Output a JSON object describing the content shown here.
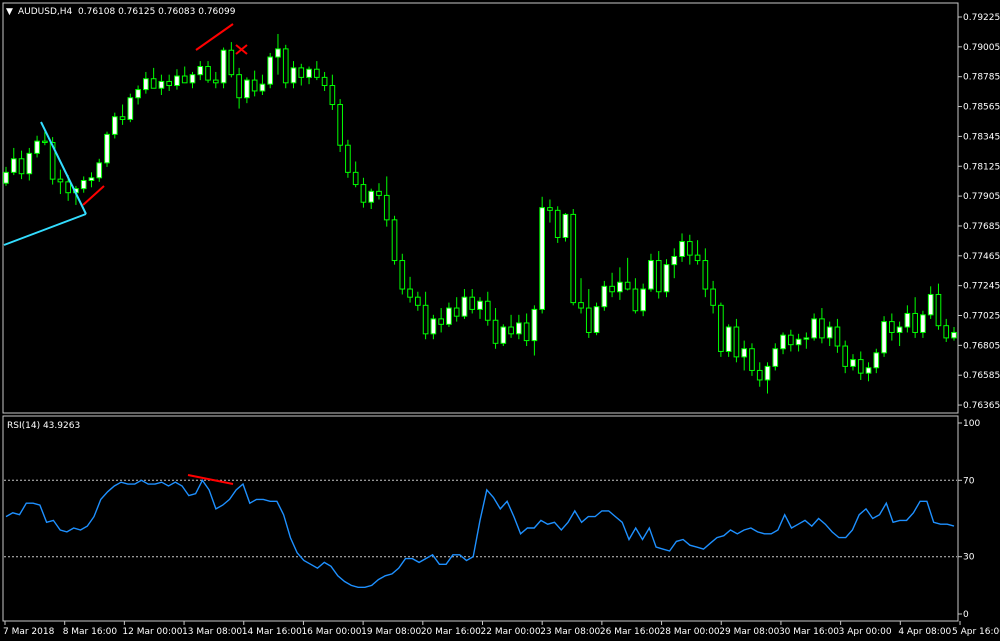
{
  "chart_data": [
    {
      "type": "candlestick",
      "symbol_label": "AUDUSD,H4",
      "ohlc_label": "0.76108 0.76125 0.76083 0.76099",
      "y_ticks": [
        "0.79225",
        "0.79005",
        "0.78785",
        "0.78565",
        "0.78345",
        "0.78125",
        "0.77905",
        "0.77685",
        "0.77465",
        "0.77245",
        "0.77025",
        "0.76805",
        "0.76585",
        "0.76365"
      ],
      "ylim": [
        0.7632,
        0.793
      ],
      "colors": {
        "candle": "#00ff00",
        "bull_body": "#ffffff",
        "bear_body": "#000000",
        "trendline": "#33ddff",
        "divergence": "#ff0000",
        "axis": "#ffffff"
      },
      "candles": [
        [
          0.78,
          0.7812,
          0.7798,
          0.7808
        ],
        [
          0.7808,
          0.7826,
          0.7806,
          0.7818
        ],
        [
          0.7818,
          0.7824,
          0.7803,
          0.7807
        ],
        [
          0.7807,
          0.7826,
          0.7802,
          0.7822
        ],
        [
          0.7822,
          0.7835,
          0.7819,
          0.7831
        ],
        [
          0.7831,
          0.7838,
          0.7828,
          0.783
        ],
        [
          0.783,
          0.7834,
          0.7799,
          0.7803
        ],
        [
          0.7803,
          0.781,
          0.7792,
          0.7801
        ],
        [
          0.7801,
          0.7806,
          0.7787,
          0.7793
        ],
        [
          0.7793,
          0.7798,
          0.7784,
          0.7796
        ],
        [
          0.7796,
          0.7805,
          0.7793,
          0.7802
        ],
        [
          0.7802,
          0.7808,
          0.7797,
          0.7804
        ],
        [
          0.7804,
          0.7818,
          0.7801,
          0.7815
        ],
        [
          0.7815,
          0.7838,
          0.7812,
          0.7836
        ],
        [
          0.7836,
          0.7852,
          0.7833,
          0.7849
        ],
        [
          0.7849,
          0.7858,
          0.7843,
          0.7847
        ],
        [
          0.7847,
          0.7866,
          0.7845,
          0.7863
        ],
        [
          0.7863,
          0.7872,
          0.7858,
          0.7869
        ],
        [
          0.7869,
          0.7882,
          0.7866,
          0.7877
        ],
        [
          0.7877,
          0.7885,
          0.787,
          0.787
        ],
        [
          0.787,
          0.788,
          0.7865,
          0.7875
        ],
        [
          0.7875,
          0.788,
          0.7868,
          0.7872
        ],
        [
          0.7872,
          0.7884,
          0.7869,
          0.7879
        ],
        [
          0.7879,
          0.7886,
          0.7874,
          0.7874
        ],
        [
          0.7874,
          0.7882,
          0.787,
          0.788
        ],
        [
          0.788,
          0.789,
          0.7876,
          0.7886
        ],
        [
          0.7886,
          0.789,
          0.7874,
          0.7876
        ],
        [
          0.7876,
          0.7882,
          0.787,
          0.7874
        ],
        [
          0.7874,
          0.79,
          0.787,
          0.7898
        ],
        [
          0.7898,
          0.7904,
          0.7878,
          0.788
        ],
        [
          0.788,
          0.7885,
          0.7855,
          0.7863
        ],
        [
          0.7863,
          0.7878,
          0.7859,
          0.7876
        ],
        [
          0.7876,
          0.7883,
          0.7864,
          0.7868
        ],
        [
          0.7868,
          0.788,
          0.7865,
          0.7873
        ],
        [
          0.7873,
          0.7896,
          0.787,
          0.7893
        ],
        [
          0.7893,
          0.791,
          0.788,
          0.7899
        ],
        [
          0.7899,
          0.7902,
          0.787,
          0.7874
        ],
        [
          0.7874,
          0.789,
          0.787,
          0.7885
        ],
        [
          0.7885,
          0.7888,
          0.7872,
          0.7878
        ],
        [
          0.7878,
          0.7886,
          0.7873,
          0.7884
        ],
        [
          0.7884,
          0.789,
          0.7876,
          0.7878
        ],
        [
          0.7878,
          0.7882,
          0.7868,
          0.7872
        ],
        [
          0.7872,
          0.788,
          0.7854,
          0.7858
        ],
        [
          0.7858,
          0.7862,
          0.7823,
          0.7828
        ],
        [
          0.7828,
          0.7832,
          0.7804,
          0.7808
        ],
        [
          0.7808,
          0.7816,
          0.7797,
          0.7799
        ],
        [
          0.7799,
          0.7804,
          0.7782,
          0.7786
        ],
        [
          0.7786,
          0.7796,
          0.7781,
          0.7794
        ],
        [
          0.7794,
          0.78,
          0.7788,
          0.7791
        ],
        [
          0.7791,
          0.7805,
          0.7768,
          0.7773
        ],
        [
          0.7773,
          0.7776,
          0.774,
          0.7743
        ],
        [
          0.7743,
          0.7748,
          0.7718,
          0.7722
        ],
        [
          0.7722,
          0.7731,
          0.7712,
          0.7716
        ],
        [
          0.7716,
          0.772,
          0.7706,
          0.771
        ],
        [
          0.771,
          0.772,
          0.7685,
          0.7689
        ],
        [
          0.7689,
          0.7703,
          0.7685,
          0.77
        ],
        [
          0.77,
          0.7708,
          0.769,
          0.7696
        ],
        [
          0.7696,
          0.7712,
          0.7694,
          0.7708
        ],
        [
          0.7708,
          0.7716,
          0.7698,
          0.7702
        ],
        [
          0.7702,
          0.7722,
          0.77,
          0.7716
        ],
        [
          0.7716,
          0.7722,
          0.7704,
          0.7707
        ],
        [
          0.7707,
          0.7716,
          0.77,
          0.7713
        ],
        [
          0.7713,
          0.772,
          0.7695,
          0.7699
        ],
        [
          0.7699,
          0.7708,
          0.7678,
          0.7682
        ],
        [
          0.7682,
          0.7696,
          0.768,
          0.7694
        ],
        [
          0.7694,
          0.7703,
          0.7686,
          0.7689
        ],
        [
          0.7689,
          0.7703,
          0.7685,
          0.7697
        ],
        [
          0.7697,
          0.7704,
          0.768,
          0.7684
        ],
        [
          0.7684,
          0.771,
          0.7673,
          0.7707
        ],
        [
          0.7707,
          0.779,
          0.7704,
          0.7782
        ],
        [
          0.7782,
          0.7788,
          0.7771,
          0.778
        ],
        [
          0.778,
          0.7783,
          0.7756,
          0.776
        ],
        [
          0.776,
          0.7778,
          0.7757,
          0.7777
        ],
        [
          0.7777,
          0.7781,
          0.771,
          0.7712
        ],
        [
          0.7712,
          0.773,
          0.7704,
          0.7708
        ],
        [
          0.7708,
          0.7722,
          0.7686,
          0.769
        ],
        [
          0.769,
          0.7712,
          0.7688,
          0.7709
        ],
        [
          0.7709,
          0.7728,
          0.7706,
          0.7724
        ],
        [
          0.7724,
          0.7734,
          0.7716,
          0.772
        ],
        [
          0.772,
          0.7738,
          0.7714,
          0.7727
        ],
        [
          0.7727,
          0.7745,
          0.7721,
          0.7722
        ],
        [
          0.7722,
          0.773,
          0.7704,
          0.7706
        ],
        [
          0.7706,
          0.7726,
          0.7702,
          0.7722
        ],
        [
          0.7722,
          0.7748,
          0.772,
          0.7743
        ],
        [
          0.7743,
          0.775,
          0.7715,
          0.772
        ],
        [
          0.772,
          0.7744,
          0.7716,
          0.774
        ],
        [
          0.774,
          0.7752,
          0.773,
          0.7746
        ],
        [
          0.7746,
          0.7763,
          0.7742,
          0.7757
        ],
        [
          0.7757,
          0.7762,
          0.774,
          0.7747
        ],
        [
          0.7747,
          0.7758,
          0.774,
          0.7743
        ],
        [
          0.7743,
          0.7752,
          0.7716,
          0.7722
        ],
        [
          0.7722,
          0.7728,
          0.7704,
          0.771
        ],
        [
          0.771,
          0.7712,
          0.7672,
          0.7676
        ],
        [
          0.7676,
          0.7696,
          0.7672,
          0.7694
        ],
        [
          0.7694,
          0.77,
          0.7668,
          0.7672
        ],
        [
          0.7672,
          0.7684,
          0.7662,
          0.7678
        ],
        [
          0.7678,
          0.7682,
          0.7658,
          0.7662
        ],
        [
          0.7662,
          0.7668,
          0.765,
          0.7655
        ],
        [
          0.7655,
          0.7668,
          0.7645,
          0.7665
        ],
        [
          0.7665,
          0.7682,
          0.7662,
          0.7678
        ],
        [
          0.7678,
          0.769,
          0.7674,
          0.7688
        ],
        [
          0.7688,
          0.7692,
          0.7676,
          0.7681
        ],
        [
          0.7681,
          0.7689,
          0.7676,
          0.7685
        ],
        [
          0.7685,
          0.769,
          0.7678,
          0.7686
        ],
        [
          0.7686,
          0.7704,
          0.7684,
          0.77
        ],
        [
          0.77,
          0.7708,
          0.7682,
          0.7686
        ],
        [
          0.7686,
          0.7698,
          0.768,
          0.7694
        ],
        [
          0.7694,
          0.77,
          0.7675,
          0.768
        ],
        [
          0.768,
          0.7684,
          0.766,
          0.7665
        ],
        [
          0.7665,
          0.7674,
          0.7662,
          0.767
        ],
        [
          0.767,
          0.7676,
          0.7655,
          0.766
        ],
        [
          0.766,
          0.7668,
          0.7654,
          0.7664
        ],
        [
          0.7664,
          0.7678,
          0.766,
          0.7675
        ],
        [
          0.7675,
          0.7702,
          0.7672,
          0.7698
        ],
        [
          0.7698,
          0.7704,
          0.7684,
          0.769
        ],
        [
          0.769,
          0.7698,
          0.768,
          0.7694
        ],
        [
          0.7694,
          0.771,
          0.769,
          0.7704
        ],
        [
          0.7704,
          0.7716,
          0.7686,
          0.769
        ],
        [
          0.769,
          0.7706,
          0.7686,
          0.7703
        ],
        [
          0.7703,
          0.7724,
          0.77,
          0.7718
        ],
        [
          0.7718,
          0.7726,
          0.7692,
          0.7695
        ],
        [
          0.7695,
          0.77,
          0.7683,
          0.7686
        ],
        [
          0.7686,
          0.7694,
          0.7684,
          0.769
        ]
      ],
      "x_labels": [
        "7 Mar 2018",
        "8 Mar 16:00",
        "12 Mar 00:00",
        "13 Mar 08:00",
        "14 Mar 16:00",
        "16 Mar 00:00",
        "19 Mar 08:00",
        "20 Mar 16:00",
        "22 Mar 00:00",
        "23 Mar 08:00",
        "26 Mar 16:00",
        "28 Mar 00:00",
        "29 Mar 08:00",
        "30 Mar 16:00",
        "3 Apr 00:00",
        "4 Apr 08:00",
        "5 Apr 16:00"
      ]
    },
    {
      "type": "line",
      "indicator_label": "RSI(14) 43.9263",
      "y_ticks": [
        "100",
        "70",
        "30",
        "0"
      ],
      "ylim": [
        0,
        100
      ],
      "levels": [
        70,
        30
      ],
      "series": [
        {
          "color": "#1e90ff",
          "values": [
            51,
            53,
            52,
            58,
            58,
            57,
            48,
            49,
            44,
            43,
            45,
            44,
            46,
            51,
            60,
            64,
            67,
            69,
            68,
            68,
            70,
            68,
            68,
            69,
            67,
            69,
            67,
            62,
            63,
            70,
            65,
            55,
            57,
            60,
            65,
            68,
            58,
            60,
            60,
            59,
            59,
            52,
            40,
            32,
            28,
            26,
            24,
            27,
            25,
            20,
            17,
            15,
            14,
            14,
            15,
            18,
            20,
            21,
            24,
            29,
            29,
            27,
            29,
            31,
            26,
            26,
            31,
            31,
            28,
            30,
            49,
            65,
            61,
            55,
            59,
            51,
            42,
            45,
            45,
            49,
            47,
            48,
            44,
            48,
            54,
            48,
            51,
            51,
            54,
            54,
            51,
            48,
            39,
            45,
            39,
            45,
            35,
            34,
            33,
            38,
            39,
            36,
            35,
            34,
            37,
            40,
            41,
            44,
            42,
            44,
            45,
            43,
            42,
            42,
            44,
            52,
            45,
            47,
            49,
            46,
            50,
            47,
            43,
            40,
            40,
            44,
            52,
            55,
            50,
            52,
            58,
            48,
            49,
            49,
            53,
            59,
            59,
            48,
            47,
            47,
            46
          ]
        }
      ]
    }
  ]
}
